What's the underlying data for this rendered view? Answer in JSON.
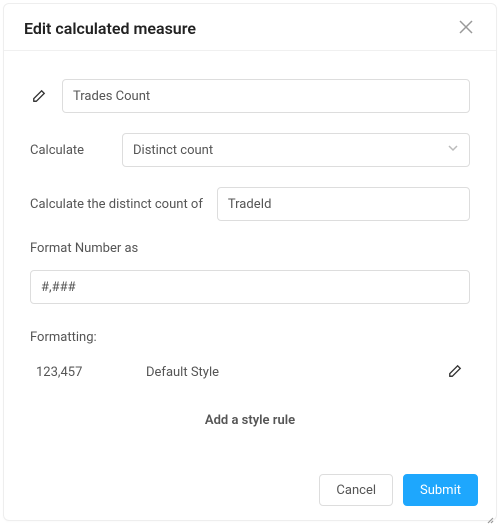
{
  "dialog": {
    "title": "Edit calculated measure"
  },
  "name": {
    "value": "Trades Count"
  },
  "calculate": {
    "label": "Calculate",
    "selected": "Distinct count"
  },
  "distinct": {
    "label": "Calculate the distinct count of",
    "value": "TradeId"
  },
  "format": {
    "label": "Format Number as",
    "value": "#,###"
  },
  "formatting": {
    "label": "Formatting:",
    "example": "123,457",
    "style": "Default Style"
  },
  "add_rule": "Add a style rule",
  "footer": {
    "cancel": "Cancel",
    "submit": "Submit"
  }
}
